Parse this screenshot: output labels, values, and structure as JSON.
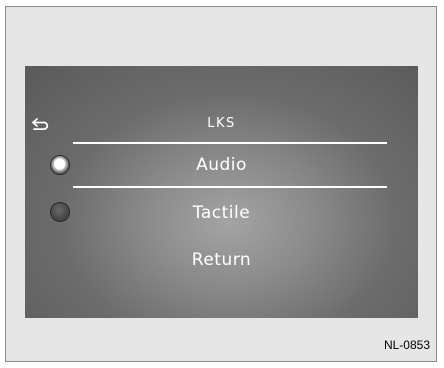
{
  "screen": {
    "title": "LKS",
    "back_icon": "back-arrow-icon",
    "options": [
      {
        "label": "Audio",
        "selected": true
      },
      {
        "label": "Tactile",
        "selected": false
      },
      {
        "label": "Return"
      }
    ]
  },
  "figure_code": "NL-0853"
}
